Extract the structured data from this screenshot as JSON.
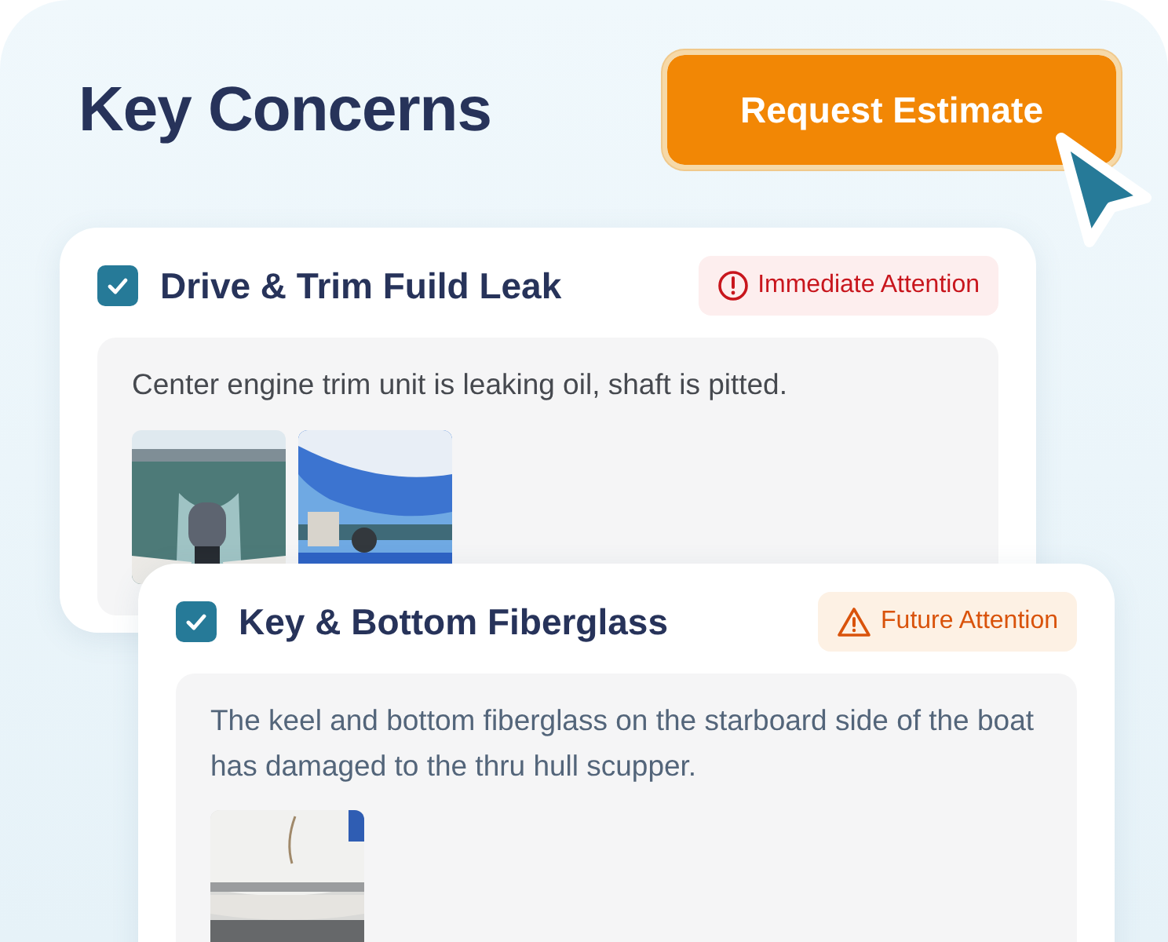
{
  "title": "Key Concerns",
  "button": {
    "label": "Request Estimate"
  },
  "concerns": [
    {
      "title": "Drive & Trim Fuild Leak",
      "checked": true,
      "badge": {
        "kind": "immediate",
        "label": "Immediate Attention"
      },
      "description": "Center engine trim unit is leaking oil, shaft is pitted."
    },
    {
      "title": "Key & Bottom Fiberglass",
      "checked": true,
      "badge": {
        "kind": "future",
        "label": "Future Attention"
      },
      "description": "The keel and bottom fiberglass on the starboard side of the boat has damaged to the thru hull scupper."
    }
  ]
}
